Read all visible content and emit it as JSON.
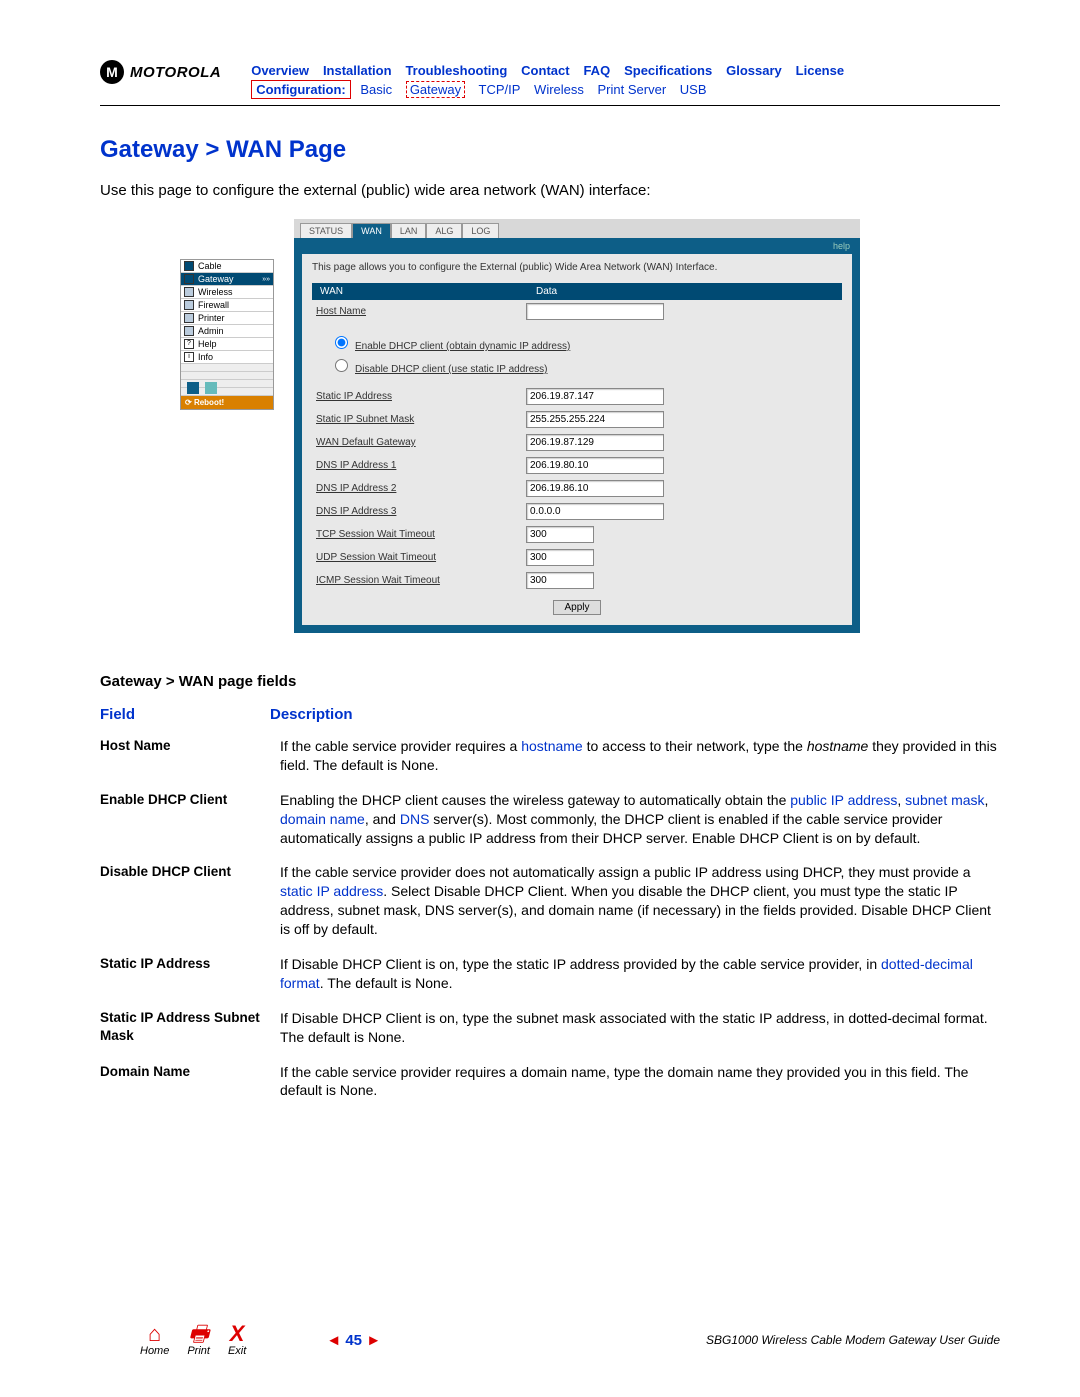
{
  "logo_text": "MOTOROLA",
  "nav1": [
    "Overview",
    "Installation",
    "Troubleshooting",
    "Contact",
    "FAQ",
    "Specifications",
    "Glossary",
    "License"
  ],
  "nav2_config": "Configuration:",
  "nav2": [
    "Basic",
    "Gateway",
    "TCP/IP",
    "Wireless",
    "Print Server",
    "USB"
  ],
  "page_title": "Gateway > WAN Page",
  "intro": "Use this page to configure the external (public) wide area network (WAN) interface:",
  "screenshot": {
    "sidebar": [
      "Cable",
      "Gateway",
      "Wireless",
      "Firewall",
      "Printer",
      "Admin",
      "Help",
      "Info"
    ],
    "reboot": "Reboot!",
    "tabs": [
      "STATUS",
      "WAN",
      "LAN",
      "ALG",
      "LOG"
    ],
    "help": "help",
    "panel_desc": "This page allows you to configure the External (public) Wide Area Network (WAN) Interface.",
    "th1": "WAN",
    "th2": "Data",
    "host_name_label": "Host Name",
    "radio1": "Enable DHCP client (obtain dynamic IP address)",
    "radio2": "Disable DHCP client (use static IP address)",
    "rows": [
      {
        "label": "Static IP Address",
        "value": "206.19.87.147"
      },
      {
        "label": "Static IP Subnet Mask",
        "value": "255.255.255.224"
      },
      {
        "label": "WAN Default Gateway",
        "value": "206.19.87.129"
      },
      {
        "label": "DNS IP Address 1",
        "value": "206.19.80.10"
      },
      {
        "label": "DNS IP Address 2",
        "value": "206.19.86.10"
      },
      {
        "label": "DNS IP Address 3",
        "value": "0.0.0.0"
      },
      {
        "label": "TCP Session Wait Timeout",
        "value": "300"
      },
      {
        "label": "UDP Session Wait Timeout",
        "value": "300"
      },
      {
        "label": "ICMP Session Wait Timeout",
        "value": "300"
      }
    ],
    "apply": "Apply"
  },
  "fields_title": "Gateway > WAN page fields",
  "col_field": "Field",
  "col_desc": "Description",
  "fields": {
    "f0_name": "Host Name",
    "f0_a": "If the cable service provider requires a ",
    "f0_b": "hostname",
    "f0_c": " to access to their network, type the ",
    "f0_d": "hostname",
    "f0_e": " they provided in this field. The default is None.",
    "f1_name": "Enable DHCP Client",
    "f1_a": "Enabling the DHCP client causes the wireless gateway to automatically obtain the ",
    "f1_b": "public IP address",
    "f1_c": ", ",
    "f1_d": "subnet mask",
    "f1_e": ", ",
    "f1_f": "domain name",
    "f1_g": ", and ",
    "f1_h": "DNS",
    "f1_i": " server(s). Most commonly, the DHCP client is enabled if the cable service provider automatically assigns a public IP address from their DHCP server. Enable DHCP Client is on by default.",
    "f2_name": "Disable DHCP Client",
    "f2_a": "If the cable service provider does not automatically assign a public IP address using DHCP, they must provide a ",
    "f2_b": "static IP address",
    "f2_c": ". Select Disable DHCP Client. When you disable the DHCP client, you must type the static IP address, subnet mask, DNS server(s), and domain name (if necessary) in the fields provided. Disable DHCP Client is off by default.",
    "f3_name": "Static IP Address",
    "f3_a": "If Disable DHCP Client is on, type the static IP address provided by the cable service provider, in ",
    "f3_b": "dotted-decimal format",
    "f3_c": ". The default is None.",
    "f4_name": "Static IP Address Subnet Mask",
    "f4_desc": "If Disable DHCP Client is on, type the subnet mask associated with the static IP address, in dotted-decimal format. The default is None.",
    "f5_name": "Domain Name",
    "f5_desc": "If the cable service provider requires a domain name, type the domain name they provided you in this field. The default is None."
  },
  "footer": {
    "home": "Home",
    "print": "Print",
    "exit": "Exit",
    "page": "45",
    "guide": "SBG1000 Wireless Cable Modem Gateway User Guide"
  }
}
